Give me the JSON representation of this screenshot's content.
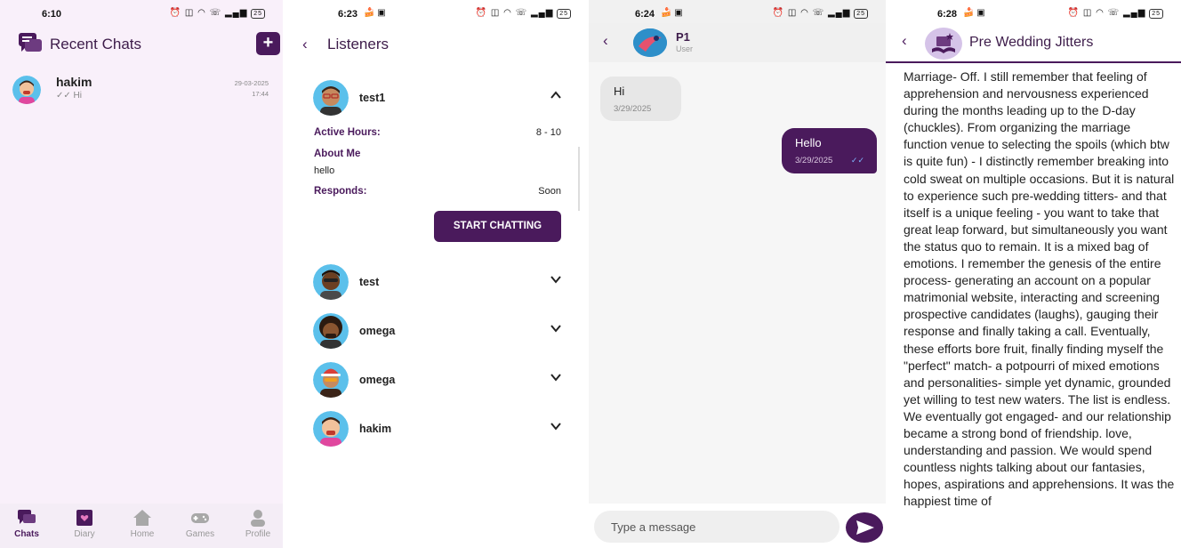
{
  "colors": {
    "primary": "#4a1a5c",
    "screen1_bg": "#f9f0fa",
    "read_tick": "#7fb6ff"
  },
  "screen1": {
    "status": {
      "time": "6:10",
      "battery": "25"
    },
    "header": {
      "title": "Recent Chats",
      "new_chat_icon": "plus-icon"
    },
    "chats": [
      {
        "name": "hakim",
        "last_message": "Hi",
        "date": "29-03-2025",
        "time": "17:44"
      }
    ],
    "nav": [
      {
        "label": "Chats",
        "icon": "chat-icon",
        "active": true
      },
      {
        "label": "Diary",
        "icon": "diary-icon",
        "active": false
      },
      {
        "label": "Home",
        "icon": "home-icon",
        "active": false
      },
      {
        "label": "Games",
        "icon": "gamepad-icon",
        "active": false
      },
      {
        "label": "Profile",
        "icon": "person-icon",
        "active": false
      }
    ]
  },
  "screen2": {
    "status": {
      "time": "6:23",
      "battery": "25"
    },
    "title": "Listeners",
    "listeners": [
      {
        "name": "test1",
        "expanded": true
      },
      {
        "name": "test",
        "expanded": false
      },
      {
        "name": "omega",
        "expanded": false
      },
      {
        "name": "omega",
        "expanded": false
      },
      {
        "name": "hakim",
        "expanded": false
      }
    ],
    "detail": {
      "active_hours_label": "Active Hours:",
      "active_hours_value": "8 - 10",
      "about_label": "About Me",
      "about_value": "hello",
      "responds_label": "Responds:",
      "responds_value": "Soon",
      "start_button": "START CHATTING"
    }
  },
  "screen3": {
    "status": {
      "time": "6:24",
      "battery": "25"
    },
    "contact": {
      "name": "P1",
      "role": "User"
    },
    "messages": [
      {
        "text": "Hi",
        "date": "3/29/2025",
        "direction": "in"
      },
      {
        "text": "Hello",
        "date": "3/29/2025",
        "direction": "out",
        "read_icon": "double-check-icon"
      }
    ],
    "input": {
      "placeholder": "Type a message",
      "send_icon": "send-icon"
    }
  },
  "screen4": {
    "status": {
      "time": "6:28",
      "battery": "25"
    },
    "title": "Pre Wedding Jitters",
    "body": "Marriage- Off. I still remember that feeling of apprehension and nervousness experienced during the months leading up to the D-day (chuckles). From organizing the marriage function venue to selecting the spoils (which btw is quite fun) - I distinctly remember breaking into cold sweat on multiple occasions. But it is natural to experience such pre-wedding titters- and that itself is a unique feeling - you want to take that great leap forward, but simultaneously you want the status quo to remain. It is a mixed bag of emotions. I remember the genesis of the entire process- generating an account on a popular matrimonial website, interacting and screening prospective candidates (laughs), gauging their response and finally taking a call. Eventually, these efforts bore fruit, finally finding myself the \"perfect\" match- a potpourri of mixed emotions and personalities- simple yet dynamic, grounded yet willing to test new waters. The list is endless. We eventually got engaged- and our relationship became a strong bond of friendship. love, understanding and passion. We would spend countless nights talking about our fantasies, hopes, aspirations and apprehensions. It was the happiest time of"
  }
}
